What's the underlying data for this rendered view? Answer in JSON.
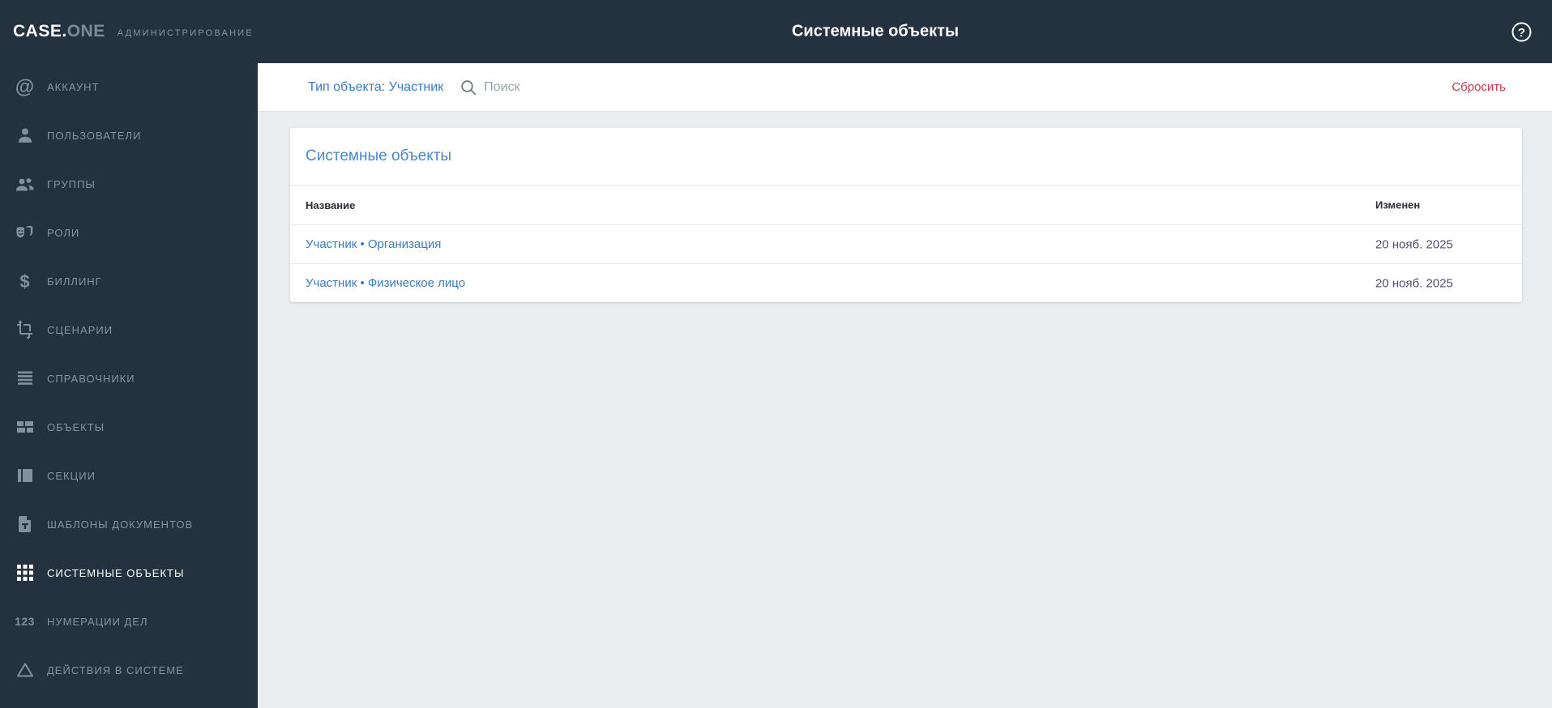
{
  "app": {
    "logo_primary": "CASE.",
    "logo_secondary": "ONE",
    "logo_caption": "АДМИНИСТРИРОВАНИЕ",
    "header_title": "Системные объекты"
  },
  "glyphs": {
    "at": "@",
    "dollar": "$",
    "numbers": "123",
    "help": "?"
  },
  "sidebar": {
    "items": [
      {
        "label": "АККАУНТ",
        "icon": "at-sign"
      },
      {
        "label": "ПОЛЬЗОВАТЕЛИ",
        "icon": "person"
      },
      {
        "label": "ГРУППЫ",
        "icon": "people"
      },
      {
        "label": "РОЛИ",
        "icon": "theater-masks"
      },
      {
        "label": "БИЛЛИНГ",
        "icon": "dollar"
      },
      {
        "label": "СЦЕНАРИИ",
        "icon": "crop-rotate"
      },
      {
        "label": "СПРАВОЧНИКИ",
        "icon": "reorder-lines"
      },
      {
        "label": "ОБЪЕКТЫ",
        "icon": "dashboard-grid"
      },
      {
        "label": "СЕКЦИИ",
        "icon": "columns"
      },
      {
        "label": "ШАБЛОНЫ ДОКУМЕНТОВ",
        "icon": "document-template"
      },
      {
        "label": "СИСТЕМНЫЕ ОБЪЕКТЫ",
        "icon": "grid-3x3",
        "active": true
      },
      {
        "label": "НУМЕРАЦИИ ДЕЛ",
        "icon": "numbers-123"
      },
      {
        "label": "ДЕЙСТВИЯ В СИСТЕМЕ",
        "icon": "triangle"
      }
    ]
  },
  "filter_bar": {
    "type_filter": "Тип объекта: Участник",
    "search_placeholder": "Поиск",
    "reset_label": "Сбросить"
  },
  "content": {
    "card_title": "Системные объекты",
    "table": {
      "columns": [
        "Название",
        "Изменен"
      ],
      "rows": [
        {
          "name": "Участник • Организация",
          "modified": "20 нояб. 2025"
        },
        {
          "name": "Участник • Физическое лицо",
          "modified": "20 нояб. 2025"
        }
      ]
    }
  },
  "colors": {
    "sidebar_bg": "#243240",
    "content_bg": "#ebeef0",
    "link_blue": "#3c7ac3",
    "card_title_blue": "#4888ca",
    "reset_red": "#d2344b",
    "date_text": "#514d74"
  }
}
